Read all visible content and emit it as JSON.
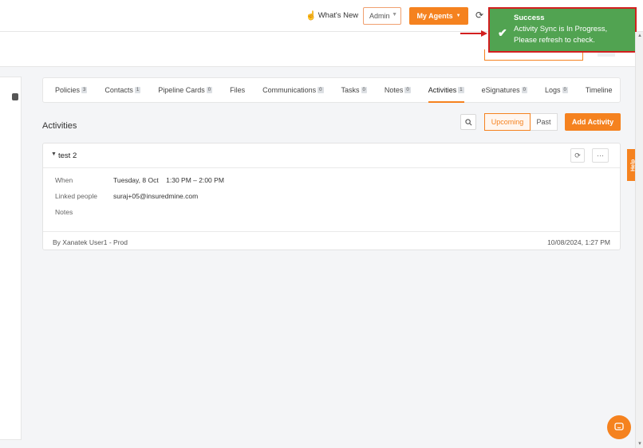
{
  "header": {
    "whats_new": "What's New",
    "role_select": "Admin",
    "my_agents": "My Agents"
  },
  "tabs": [
    {
      "label": "Policies",
      "count": "3"
    },
    {
      "label": "Contacts",
      "count": "1"
    },
    {
      "label": "Pipeline Cards",
      "count": "0"
    },
    {
      "label": "Files",
      "count": ""
    },
    {
      "label": "Communications",
      "count": "0"
    },
    {
      "label": "Tasks",
      "count": "0"
    },
    {
      "label": "Notes",
      "count": "0"
    },
    {
      "label": "Activities",
      "count": "1"
    },
    {
      "label": "eSignatures",
      "count": "0"
    },
    {
      "label": "Logs",
      "count": "0"
    },
    {
      "label": "Timeline",
      "count": ""
    }
  ],
  "activities": {
    "title": "Activities",
    "filter_upcoming": "Upcoming",
    "filter_past": "Past",
    "add_button": "Add Activity"
  },
  "activity_card": {
    "name": "test 2",
    "when_label": "When",
    "when_value": "Tuesday, 8 Oct    1:30 PM – 2:00 PM",
    "linked_label": "Linked people",
    "linked_value": "suraj+05@insuredmine.com",
    "notes_label": "Notes",
    "created_by": "By Xanatek User1 - Prod",
    "timestamp": "10/08/2024, 1:27 PM"
  },
  "toast": {
    "title": "Success",
    "message": "Activity Sync is In Progress, Please refresh to check."
  },
  "help": "Help",
  "colors": {
    "accent": "#f5821f",
    "toast_bg": "#51a351",
    "toast_border": "#d21f1f"
  }
}
